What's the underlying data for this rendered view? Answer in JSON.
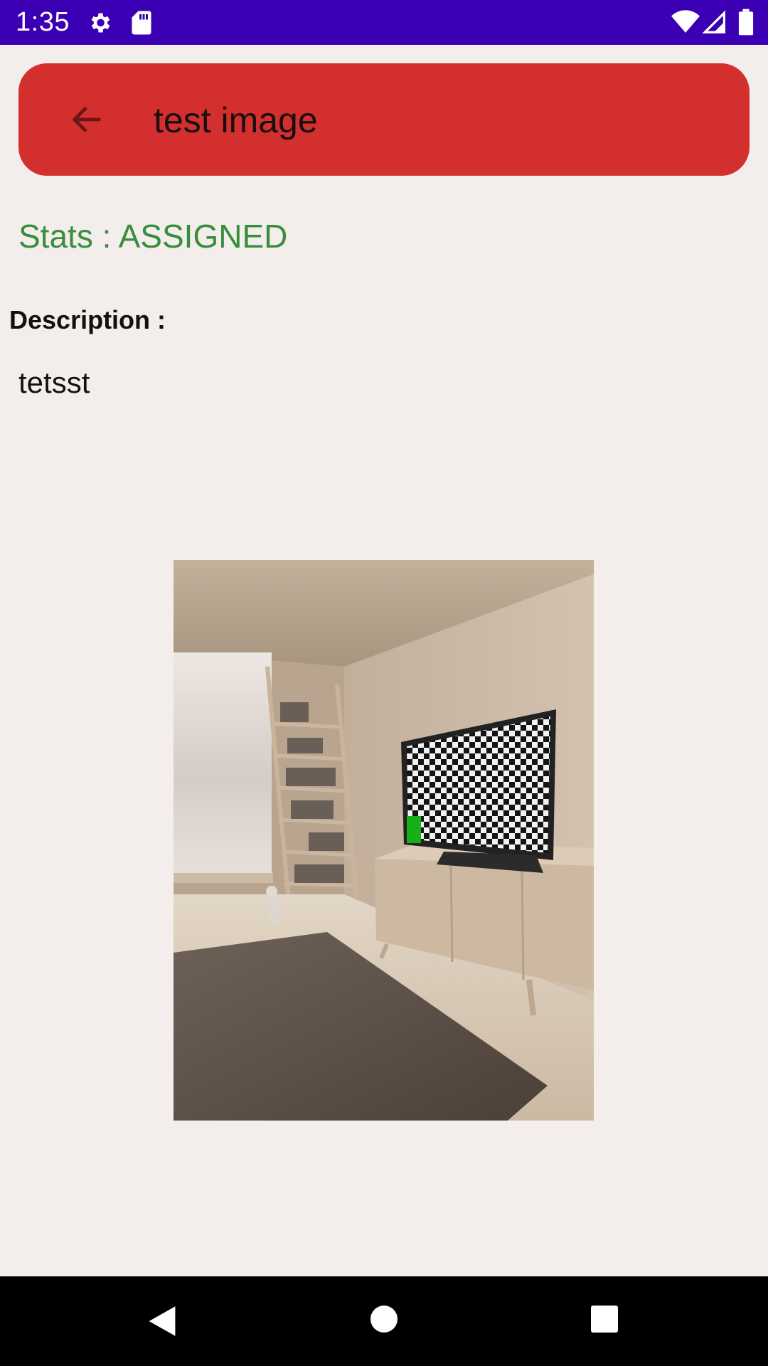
{
  "status_bar": {
    "time": "1:35",
    "background": "#3c00b4",
    "icons": [
      "gear-icon",
      "sd-card-icon",
      "wifi-icon",
      "signal-icon",
      "battery-icon"
    ]
  },
  "app_bar": {
    "title": "test image",
    "background": "#d32f2f",
    "back_icon": "arrow-left-icon"
  },
  "task": {
    "status_text": "Stats : ASSIGNED",
    "status_color": "#388e3c",
    "description_label": "Description :",
    "description_value": "tetsst"
  },
  "nav_bar": {
    "buttons": [
      "back-triangle-icon",
      "home-circle-icon",
      "recents-square-icon"
    ]
  }
}
